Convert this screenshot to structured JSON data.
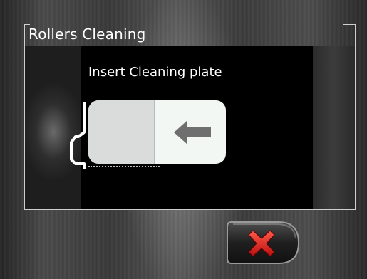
{
  "dialog": {
    "title": "Rollers Cleaning",
    "instruction": "Insert Cleaning plate"
  },
  "illustration": {
    "plate_icon": "cleaning-plate",
    "direction_icon": "arrow-left-icon"
  },
  "actions": {
    "cancel_icon": "close-icon",
    "cancel_icon_color": "#e02828"
  }
}
